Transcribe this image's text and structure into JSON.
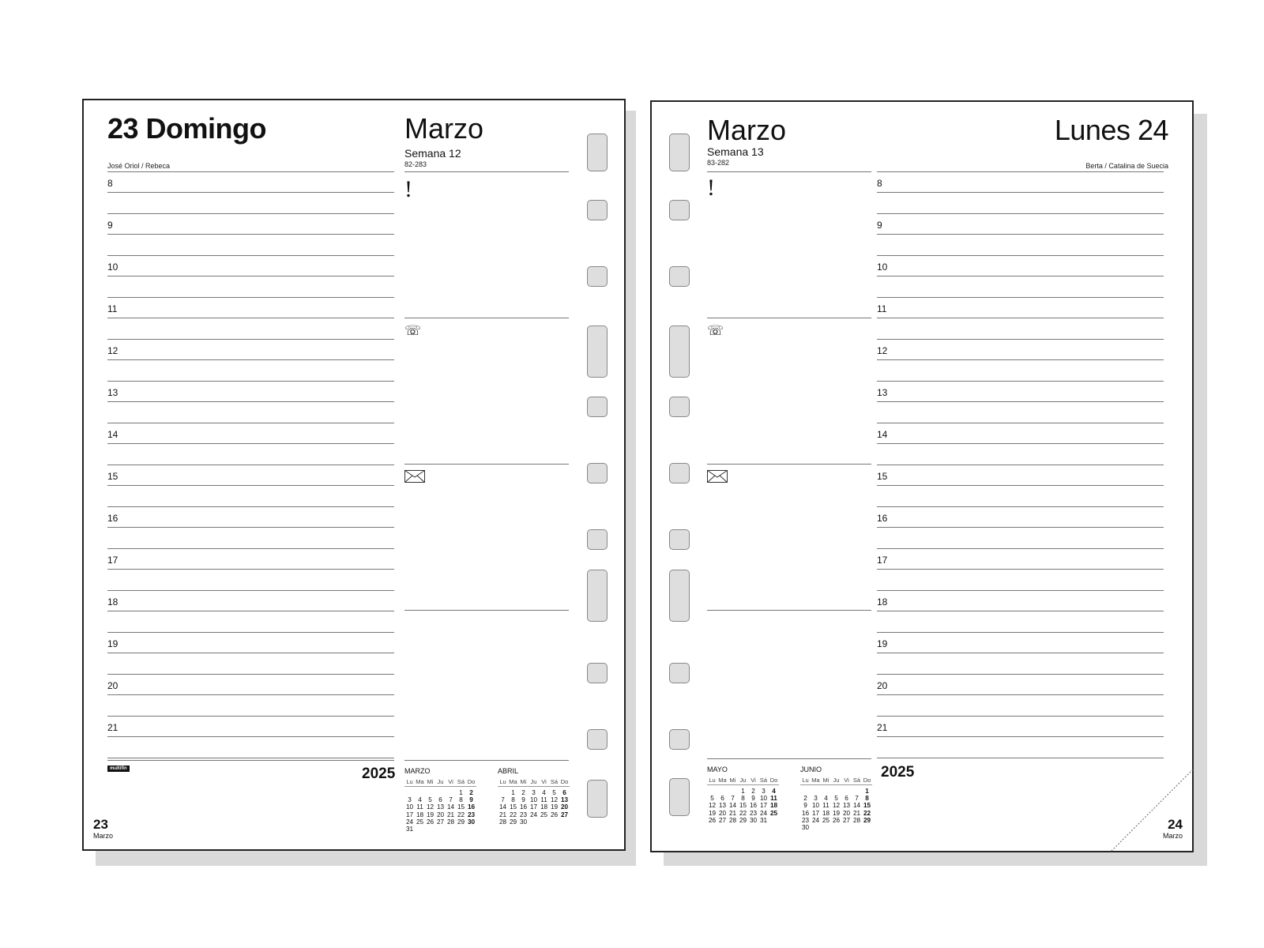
{
  "left_page": {
    "day_title": "23 Domingo",
    "saints": "José Oriol / Rebeca",
    "month": "Marzo",
    "week": "Semana 12",
    "day_count": "82-283",
    "hours": [
      "8",
      "9",
      "10",
      "11",
      "12",
      "13",
      "14",
      "15",
      "16",
      "17",
      "18",
      "19",
      "20",
      "21"
    ],
    "brand": "multifin",
    "year": "2025",
    "footer_day": "23",
    "footer_month": "Marzo",
    "icons": [
      "exclamation-icon",
      "telephone-icon",
      "envelope-icon"
    ],
    "mini_calendars": [
      {
        "title": "MARZO",
        "headers": [
          "Lu",
          "Ma",
          "Mi",
          "Ju",
          "Vi",
          "Sá",
          "Do"
        ],
        "days": [
          "",
          "",
          "",
          "",
          "",
          "1",
          "2",
          "3",
          "4",
          "5",
          "6",
          "7",
          "8",
          "9",
          "10",
          "11",
          "12",
          "13",
          "14",
          "15",
          "16",
          "17",
          "18",
          "19",
          "20",
          "21",
          "22",
          "23",
          "24",
          "25",
          "26",
          "27",
          "28",
          "29",
          "30",
          "31",
          "",
          "",
          "",
          "",
          "",
          ""
        ]
      },
      {
        "title": "ABRIL",
        "headers": [
          "Lu",
          "Ma",
          "Mi",
          "Ju",
          "Vi",
          "Sá",
          "Do"
        ],
        "days": [
          "",
          "1",
          "2",
          "3",
          "4",
          "5",
          "6",
          "7",
          "8",
          "9",
          "10",
          "11",
          "12",
          "13",
          "14",
          "15",
          "16",
          "17",
          "18",
          "19",
          "20",
          "21",
          "22",
          "23",
          "24",
          "25",
          "26",
          "27",
          "28",
          "29",
          "30",
          "",
          "",
          "",
          ""
        ]
      }
    ]
  },
  "right_page": {
    "day_title": "Lunes 24",
    "saints": "Berta / Catalina de Suecia",
    "month": "Marzo",
    "week": "Semana 13",
    "day_count": "83-282",
    "hours": [
      "8",
      "9",
      "10",
      "11",
      "12",
      "13",
      "14",
      "15",
      "16",
      "17",
      "18",
      "19",
      "20",
      "21"
    ],
    "year": "2025",
    "footer_day": "24",
    "footer_month": "Marzo",
    "icons": [
      "exclamation-icon",
      "telephone-icon",
      "envelope-icon"
    ],
    "mini_calendars": [
      {
        "title": "MAYO",
        "headers": [
          "Lu",
          "Ma",
          "Mi",
          "Ju",
          "Vi",
          "Sá",
          "Do"
        ],
        "days": [
          "",
          "",
          "",
          "1",
          "2",
          "3",
          "4",
          "5",
          "6",
          "7",
          "8",
          "9",
          "10",
          "11",
          "12",
          "13",
          "14",
          "15",
          "16",
          "17",
          "18",
          "19",
          "20",
          "21",
          "22",
          "23",
          "24",
          "25",
          "26",
          "27",
          "28",
          "29",
          "30",
          "31",
          ""
        ]
      },
      {
        "title": "JUNIO",
        "headers": [
          "Lu",
          "Ma",
          "Mi",
          "Ju",
          "Vi",
          "Sá",
          "Do"
        ],
        "days": [
          "",
          "",
          "",
          "",
          "",
          "",
          "1",
          "2",
          "3",
          "4",
          "5",
          "6",
          "7",
          "8",
          "9",
          "10",
          "11",
          "12",
          "13",
          "14",
          "15",
          "16",
          "17",
          "18",
          "19",
          "20",
          "21",
          "22",
          "23",
          "24",
          "25",
          "26",
          "27",
          "28",
          "29",
          "30",
          "",
          "",
          "",
          "",
          "",
          ""
        ]
      }
    ]
  }
}
